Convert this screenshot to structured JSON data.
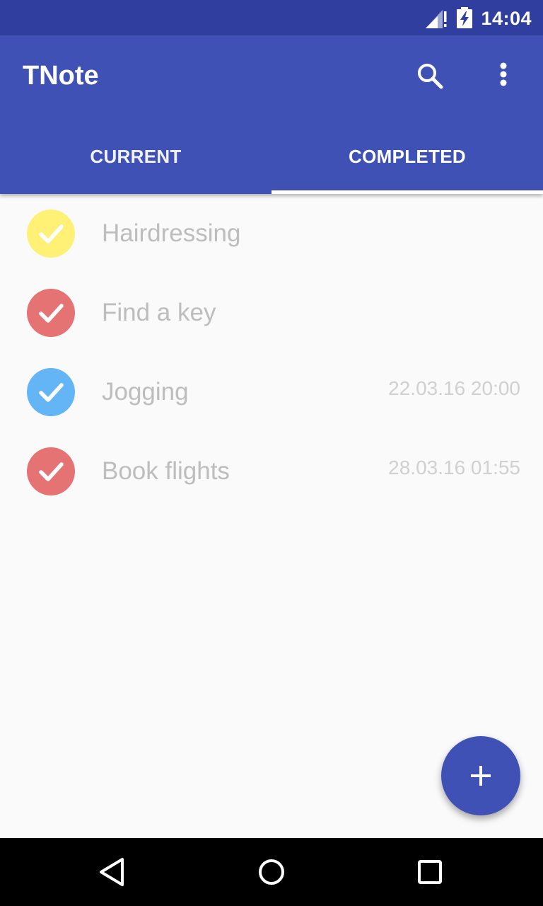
{
  "status_bar": {
    "time": "14:04",
    "signal_icon": "signal-no-data-icon",
    "battery_icon": "battery-charging-icon"
  },
  "app_bar": {
    "title": "TNote",
    "search_icon": "search-icon",
    "more_icon": "more-vert-icon",
    "color": "#3F51B5"
  },
  "tabs": [
    {
      "label": "CURRENT",
      "selected": false
    },
    {
      "label": "COMPLETED",
      "selected": true
    }
  ],
  "tasks": [
    {
      "title": "Hairdressing",
      "date": "",
      "color": "#FFF176"
    },
    {
      "title": "Find a key",
      "date": "",
      "color": "#E57373"
    },
    {
      "title": "Jogging",
      "date": "22.03.16 20:00",
      "color": "#64B5F6"
    },
    {
      "title": "Book flights",
      "date": "28.03.16 01:55",
      "color": "#E57373"
    }
  ],
  "fab": {
    "icon": "add-icon"
  },
  "nav_bar": {
    "back_icon": "back-triangle-icon",
    "home_icon": "home-circle-icon",
    "recents_icon": "recents-square-icon"
  }
}
